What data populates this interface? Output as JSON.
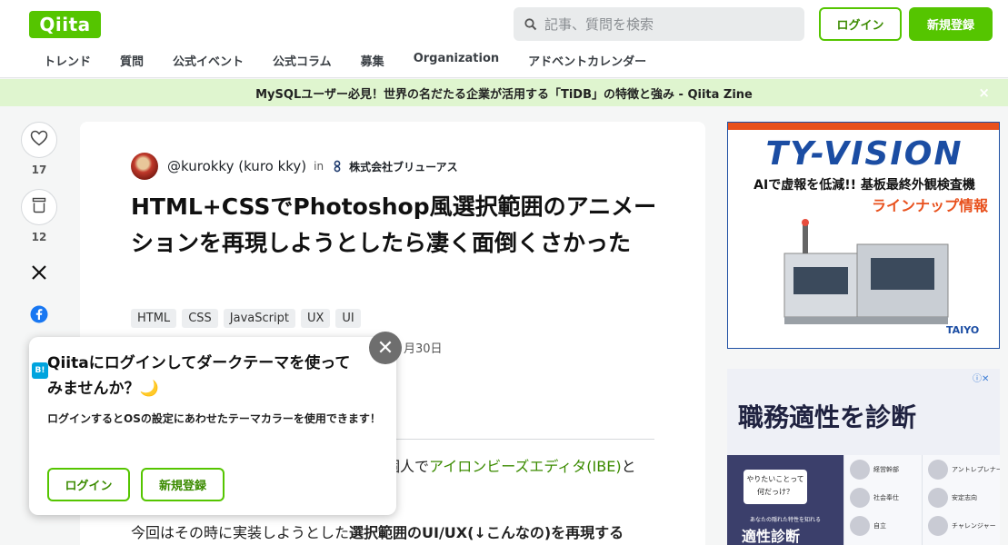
{
  "header": {
    "logo": "Qiita",
    "search_placeholder": "記事、質問を検索",
    "login_label": "ログイン",
    "signup_label": "新規登録",
    "nav": [
      "トレンド",
      "質問",
      "公式イベント",
      "公式コラム",
      "募集",
      "Organization",
      "アドベントカレンダー"
    ]
  },
  "banner": {
    "text": "MySQLユーザー必見！世界の名だたる企業が活用する「TiDB」の特徴と強み - Qiita Zine",
    "close": "×"
  },
  "rail": {
    "like_count": "17",
    "stock_count": "12"
  },
  "article": {
    "author": "@kurokky (kuro kky)",
    "in_text": "in",
    "org": "株式会社ブリューアス",
    "title": "HTML+CSSでPhotoshop風選択範囲のアニメーションを再現しようとしたら凄く面倒くさかった",
    "tags": [
      "HTML",
      "CSS",
      "JavaScript",
      "UX",
      "UI"
    ],
    "date_fragment": "月30日",
    "para1_prefix": "個人で",
    "para1_link": "アイロンビーズエディタ(IBE)",
    "para1_suffix": "と",
    "para2_prefix": "今回はその時に実装しようとした",
    "para2_bold": "選択範囲のUI/UX(↓こんなの)を再現する"
  },
  "popup": {
    "title": "Qiitaにログインしてダークテーマを使ってみませんか？🌙",
    "body": "ログインするとOSの設定にあわせたテーマカラーを使用できます！",
    "login_label": "ログイン",
    "signup_label": "新規登録",
    "close": "✕"
  },
  "ad1": {
    "logo": "TY-VISION",
    "line1": "AIで虚報を低減!! 基板最終外観検査機",
    "line2": "ラインナップ情報",
    "brand": "TAIYO"
  },
  "ad2": {
    "title": "職務適性を診断",
    "bubble": "やりたいことって何だっけ？",
    "caption": "あなたの隠れた特性を知れる",
    "big": "適性診断",
    "labels": [
      "経営幹部",
      "アントレプレナー",
      "社会奉仕",
      "安定志向",
      "自立",
      "チャレンジャー"
    ]
  },
  "colors": {
    "brand_green": "#55c500",
    "banner_bg": "#dff5cf",
    "link_green": "#3b8b00"
  }
}
